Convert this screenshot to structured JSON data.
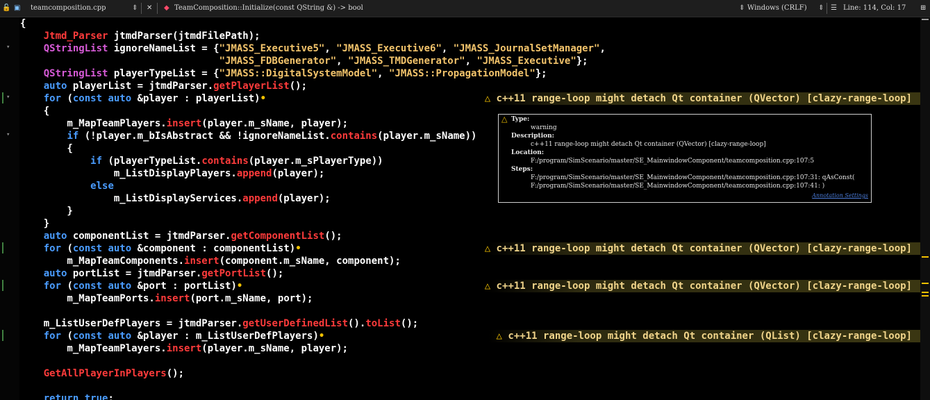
{
  "toolbar": {
    "file_name": "teamcomposition.cpp",
    "function_signature": "TeamComposition::Initialize(const QString &) -> bool",
    "line_ending": "Windows (CRLF)",
    "cursor_position": "Line: 114, Col: 17"
  },
  "code_lines": [
    [
      [
        "{",
        "#ffffff"
      ]
    ],
    [
      [
        "    ",
        ""
      ],
      [
        "Jtmd_Parser",
        "#ff3b3b"
      ],
      [
        " jtmdParser(jtmdFilePath);",
        "#ffffff"
      ]
    ],
    [
      [
        "    ",
        ""
      ],
      [
        "QStringList",
        "#d65ad6"
      ],
      [
        " ignoreNameList = {",
        "#ffffff"
      ],
      [
        "\"JMASS_Executive5\"",
        "#f2c36b"
      ],
      [
        ", ",
        "#ffffff"
      ],
      [
        "\"JMASS_Executive6\"",
        "#f2c36b"
      ],
      [
        ", ",
        "#ffffff"
      ],
      [
        "\"JMASS_JournalSetManager\"",
        "#f2c36b"
      ],
      [
        ",",
        "#ffffff"
      ]
    ],
    [
      [
        "                                  ",
        ""
      ],
      [
        "\"JMASS_FDBGenerator\"",
        "#f2c36b"
      ],
      [
        ", ",
        "#ffffff"
      ],
      [
        "\"JMASS_TMDGenerator\"",
        "#f2c36b"
      ],
      [
        ", ",
        "#ffffff"
      ],
      [
        "\"JMASS_Executive\"",
        "#f2c36b"
      ],
      [
        "};",
        "#ffffff"
      ]
    ],
    [
      [
        "    ",
        ""
      ],
      [
        "QStringList",
        "#d65ad6"
      ],
      [
        " playerTypeList = {",
        "#ffffff"
      ],
      [
        "\"JMASS::DigitalSystemModel\"",
        "#f2c36b"
      ],
      [
        ", ",
        "#ffffff"
      ],
      [
        "\"JMASS::PropagationModel\"",
        "#f2c36b"
      ],
      [
        "};",
        "#ffffff"
      ]
    ],
    [
      [
        "    ",
        ""
      ],
      [
        "auto",
        "#4a9cff"
      ],
      [
        " playerList = jtmdParser.",
        "#ffffff"
      ],
      [
        "getPlayerList",
        "#ff3b3b"
      ],
      [
        "();",
        "#ffffff"
      ]
    ],
    [
      [
        "    ",
        ""
      ],
      [
        "for",
        "#4a9cff"
      ],
      [
        " (",
        "#ffffff"
      ],
      [
        "const auto",
        "#4a9cff"
      ],
      [
        " &player : playerList)",
        "#ffffff"
      ],
      [
        "💡",
        "#f2c100"
      ]
    ],
    [
      [
        "    {",
        "#ffffff"
      ]
    ],
    [
      [
        "        m_MapTeamPlayers.",
        "#ffffff"
      ],
      [
        "insert",
        "#ff3b3b"
      ],
      [
        "(player.m_sName, player);",
        "#ffffff"
      ]
    ],
    [
      [
        "        ",
        ""
      ],
      [
        "if",
        "#4a9cff"
      ],
      [
        " (!player.m_bIsAbstract && !ignoreNameList.",
        "#ffffff"
      ],
      [
        "contains",
        "#ff3b3b"
      ],
      [
        "(player.m_sName))",
        "#ffffff"
      ]
    ],
    [
      [
        "        {",
        "#ffffff"
      ]
    ],
    [
      [
        "            ",
        ""
      ],
      [
        "if",
        "#4a9cff"
      ],
      [
        " (playerTypeList.",
        "#ffffff"
      ],
      [
        "contains",
        "#ff3b3b"
      ],
      [
        "(player.m_sPlayerType))",
        "#ffffff"
      ]
    ],
    [
      [
        "                m_ListDisplayPlayers.",
        "#ffffff"
      ],
      [
        "append",
        "#ff3b3b"
      ],
      [
        "(player);",
        "#ffffff"
      ]
    ],
    [
      [
        "            ",
        ""
      ],
      [
        "else",
        "#4a9cff"
      ]
    ],
    [
      [
        "                m_ListDisplayServices.",
        "#ffffff"
      ],
      [
        "append",
        "#ff3b3b"
      ],
      [
        "(player);",
        "#ffffff"
      ]
    ],
    [
      [
        "        }",
        "#ffffff"
      ]
    ],
    [
      [
        "    }",
        "#ffffff"
      ]
    ],
    [
      [
        "    ",
        ""
      ],
      [
        "auto",
        "#4a9cff"
      ],
      [
        " componentList = jtmdParser.",
        "#ffffff"
      ],
      [
        "getComponentList",
        "#ff3b3b"
      ],
      [
        "();",
        "#ffffff"
      ]
    ],
    [
      [
        "    ",
        ""
      ],
      [
        "for",
        "#4a9cff"
      ],
      [
        " (",
        "#ffffff"
      ],
      [
        "const auto",
        "#4a9cff"
      ],
      [
        " &component : componentList)",
        "#ffffff"
      ],
      [
        "💡",
        "#f2c100"
      ]
    ],
    [
      [
        "        m_MapTeamComponents.",
        "#ffffff"
      ],
      [
        "insert",
        "#ff3b3b"
      ],
      [
        "(component.m_sName, component);",
        "#ffffff"
      ]
    ],
    [
      [
        "    ",
        ""
      ],
      [
        "auto",
        "#4a9cff"
      ],
      [
        " portList = jtmdParser.",
        "#ffffff"
      ],
      [
        "getPortList",
        "#ff3b3b"
      ],
      [
        "();",
        "#ffffff"
      ]
    ],
    [
      [
        "    ",
        ""
      ],
      [
        "for",
        "#4a9cff"
      ],
      [
        " (",
        "#ffffff"
      ],
      [
        "const auto",
        "#4a9cff"
      ],
      [
        " &port : portList)",
        "#ffffff"
      ],
      [
        "💡",
        "#f2c100"
      ]
    ],
    [
      [
        "        m_MapTeamPorts.",
        "#ffffff"
      ],
      [
        "insert",
        "#ff3b3b"
      ],
      [
        "(port.m_sName, port);",
        "#ffffff"
      ]
    ],
    [
      [
        "",
        ""
      ]
    ],
    [
      [
        "    m_ListUserDefPlayers = jtmdParser.",
        "#ffffff"
      ],
      [
        "getUserDefinedList",
        "#ff3b3b"
      ],
      [
        "().",
        "#ffffff"
      ],
      [
        "toList",
        "#ff3b3b"
      ],
      [
        "();",
        "#ffffff"
      ]
    ],
    [
      [
        "    ",
        ""
      ],
      [
        "for",
        "#4a9cff"
      ],
      [
        " (",
        "#ffffff"
      ],
      [
        "const auto",
        "#4a9cff"
      ],
      [
        " &player : m_ListUserDefPlayers)",
        "#ffffff"
      ],
      [
        "💡",
        "#f2c100"
      ]
    ],
    [
      [
        "        m_MapTeamPlayers.",
        "#ffffff"
      ],
      [
        "insert",
        "#ff3b3b"
      ],
      [
        "(player.m_sName, player);",
        "#ffffff"
      ]
    ],
    [
      [
        "",
        ""
      ]
    ],
    [
      [
        "    ",
        ""
      ],
      [
        "GetAllPlayerInPlayers",
        "#ff3b3b"
      ],
      [
        "();",
        "#ffffff"
      ]
    ],
    [
      [
        "",
        ""
      ]
    ],
    [
      [
        "    ",
        ""
      ],
      [
        "return true",
        "#4a9cff"
      ],
      [
        ";",
        "#ffffff"
      ]
    ]
  ],
  "annotations": [
    {
      "line": 6,
      "text": "c++11 range-loop might detach Qt container (QVector) [clazy-range-loop]"
    },
    {
      "line": 18,
      "text": "c++11 range-loop might detach Qt container (QVector) [clazy-range-loop]"
    },
    {
      "line": 21,
      "text": "c++11 range-loop might detach Qt container (QVector) [clazy-range-loop]"
    },
    {
      "line": 25,
      "text": "c++11 range-loop might detach Qt container (QList) [clazy-range-loop]"
    }
  ],
  "tooltip": {
    "type_label": "Type:",
    "type_value": "warning",
    "description_label": "Description:",
    "description_value": "c++11 range-loop might detach Qt container (QVector) [clazy-range-loop]",
    "location_label": "Location:",
    "location_value": "F:/program/SimScenario/master/SE_MainwindowComponent/teamcomposition.cpp:107:5",
    "steps_label": "Steps:",
    "step_1": "F:/program/SimScenario/master/SE_MainwindowComponent/teamcomposition.cpp:107:31: qAsConst(",
    "step_2": "F:/program/SimScenario/master/SE_MainwindowComponent/teamcomposition.cpp:107:41: )",
    "settings_link": "Annotation Settings"
  },
  "colors": {
    "keyword": "#4a9cff",
    "type": "#d65ad6",
    "function": "#ff3b3b",
    "string": "#f2c36b",
    "warning": "#f2c100"
  }
}
